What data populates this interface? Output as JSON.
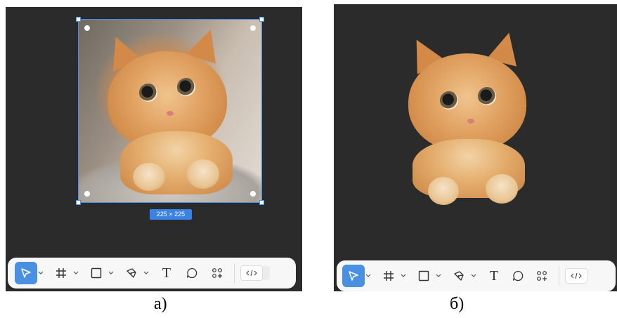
{
  "panel_a": {
    "size_badge": "225 × 225",
    "caption": "а)"
  },
  "panel_b": {
    "caption": "б)"
  },
  "toolbar": {
    "tools": [
      {
        "name": "move-tool",
        "icon": "pointer-icon",
        "active": true
      },
      {
        "name": "frame-tool",
        "icon": "hash-icon",
        "active": false
      },
      {
        "name": "shape-tool",
        "icon": "rectangle-icon",
        "active": false
      },
      {
        "name": "pen-tool",
        "icon": "pen-icon",
        "active": false
      },
      {
        "name": "text-tool",
        "icon": "text-icon",
        "text": "T",
        "active": false
      },
      {
        "name": "comment-tool",
        "icon": "comment-icon",
        "active": false
      },
      {
        "name": "actions-tool",
        "icon": "components-icon",
        "active": false
      },
      {
        "name": "dev-mode-toggle",
        "icon": "code-icon",
        "active": false
      }
    ]
  },
  "colors": {
    "canvas": "#2b2b2b",
    "accent": "#4a90e2",
    "toolbar": "#f7f7f7"
  }
}
